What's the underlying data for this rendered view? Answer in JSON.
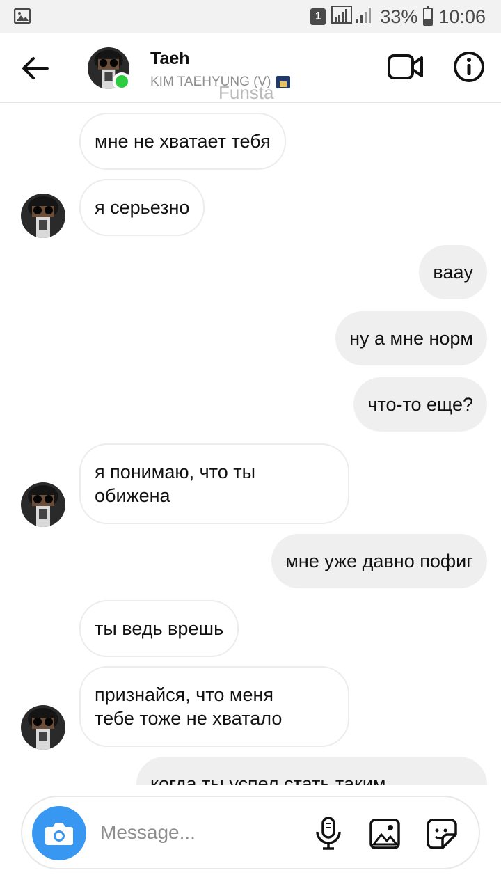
{
  "status_bar": {
    "sim_slot": "1",
    "battery_text": "33%",
    "battery_level": 0.33,
    "time": "10:06",
    "icons": [
      "image-icon",
      "signal-icon",
      "battery-icon"
    ]
  },
  "header": {
    "contact_name": "Taeh",
    "contact_subtitle": "KIM TAEHYUNG (V)",
    "watermark": "Funsta",
    "online": true,
    "icons": [
      "back-arrow-icon",
      "video-call-icon",
      "info-icon"
    ]
  },
  "messages": [
    {
      "side": "in",
      "text": "мне не хватает тебя"
    },
    {
      "side": "in",
      "text": "я серьезно"
    },
    {
      "side": "out",
      "text": "вааy"
    },
    {
      "side": "out",
      "text": "ну а мне норм"
    },
    {
      "side": "out",
      "text": "что-то еще?"
    },
    {
      "side": "in",
      "text": "я понимаю, что ты\nобижена"
    },
    {
      "side": "out",
      "text": "мне уже давно пофиг"
    },
    {
      "side": "in",
      "text": "ты ведь врешь"
    },
    {
      "side": "in",
      "text": "признайся, что меня\nтебе тоже не хватало"
    },
    {
      "side": "out",
      "text": "когда ты успел стать таким"
    }
  ],
  "composer": {
    "placeholder": "Message...",
    "icons": [
      "camera-icon",
      "microphone-icon",
      "gallery-icon",
      "sticker-icon"
    ]
  },
  "colors": {
    "accent_blue": "#3897f0",
    "online_green": "#2ecc40",
    "outgoing_bubble": "#efefef",
    "incoming_border": "#ececec"
  }
}
